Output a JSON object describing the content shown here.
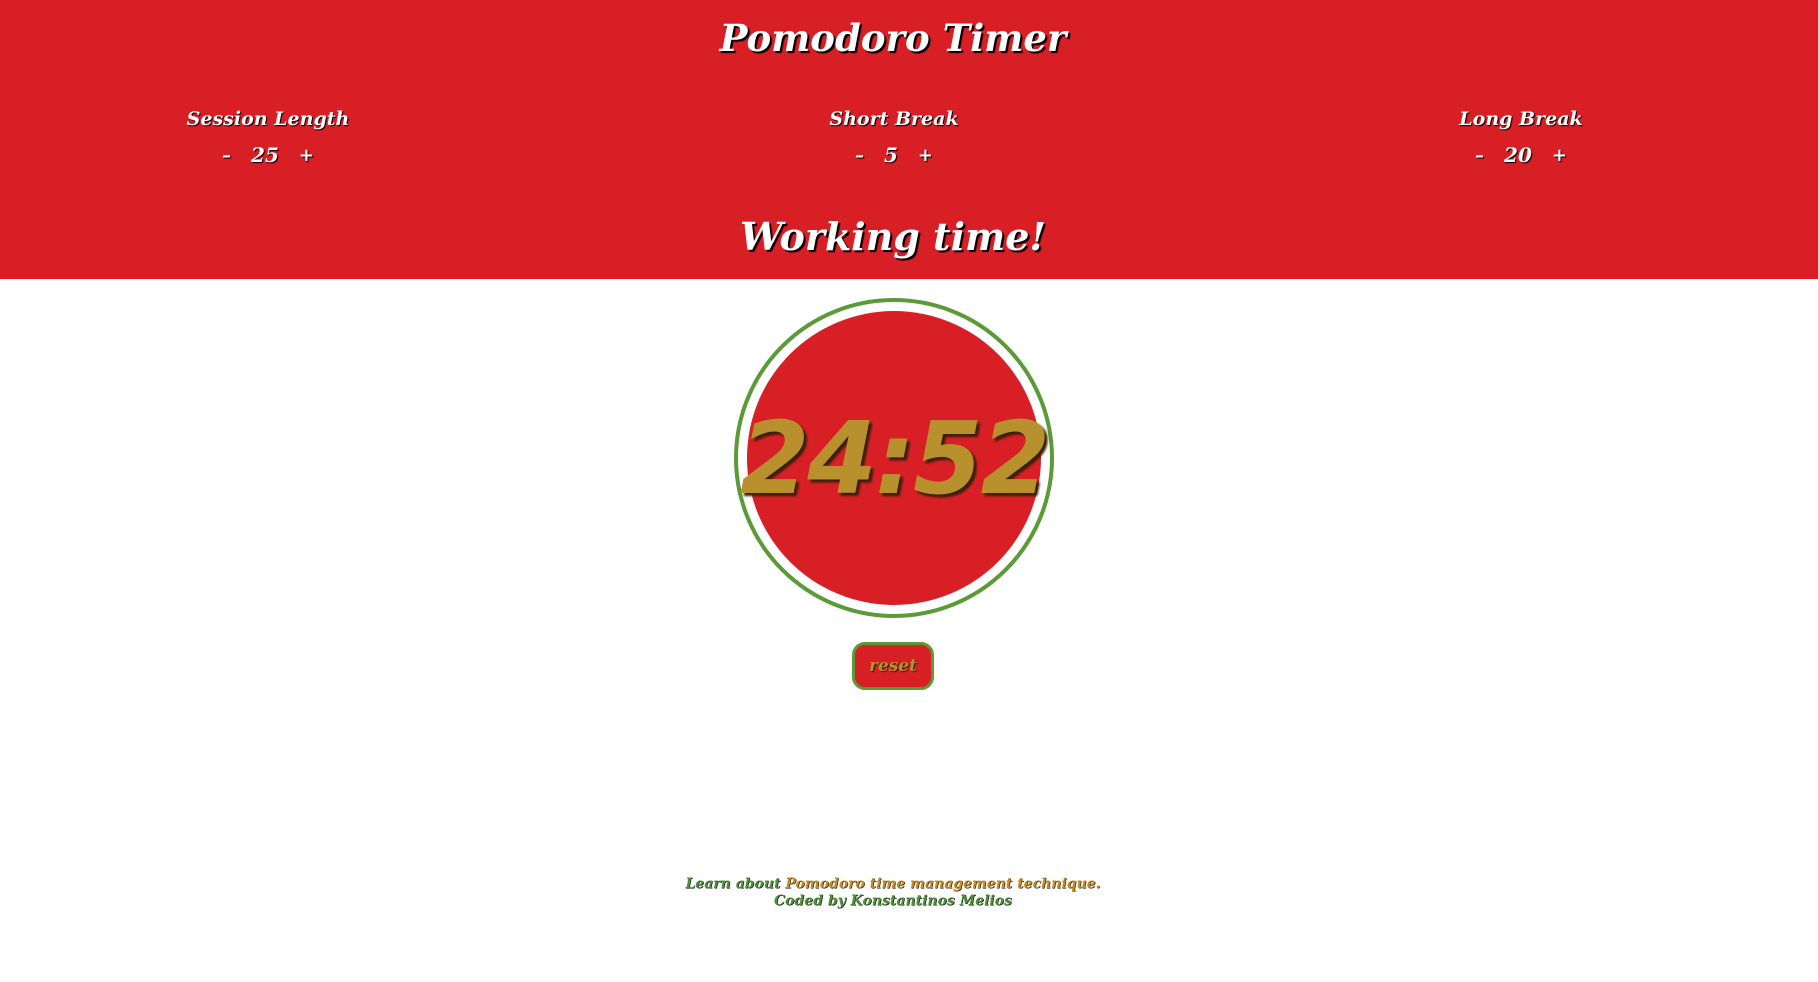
{
  "colors": {
    "header_bg": "#d91f26",
    "ring": "#5a9a37",
    "clock_text": "#b8902e",
    "footer_green": "#4f8f3c",
    "footer_link": "#c98b1e"
  },
  "header": {
    "title": "Pomodoro Timer"
  },
  "settings": [
    {
      "label": "Session Length",
      "minus": "–",
      "value": "25",
      "plus": "+"
    },
    {
      "label": "Short Break",
      "minus": "–",
      "value": "5",
      "plus": "+"
    },
    {
      "label": "Long Break",
      "minus": "–",
      "value": "20",
      "plus": "+"
    }
  ],
  "status": "Working time!",
  "timer": {
    "time": "24:52"
  },
  "reset_label": "reset",
  "footer": {
    "learn_prefix": "Learn about ",
    "learn_link": "Pomodoro time management technique.",
    "credit": "Coded by Konstantinos Melios"
  }
}
